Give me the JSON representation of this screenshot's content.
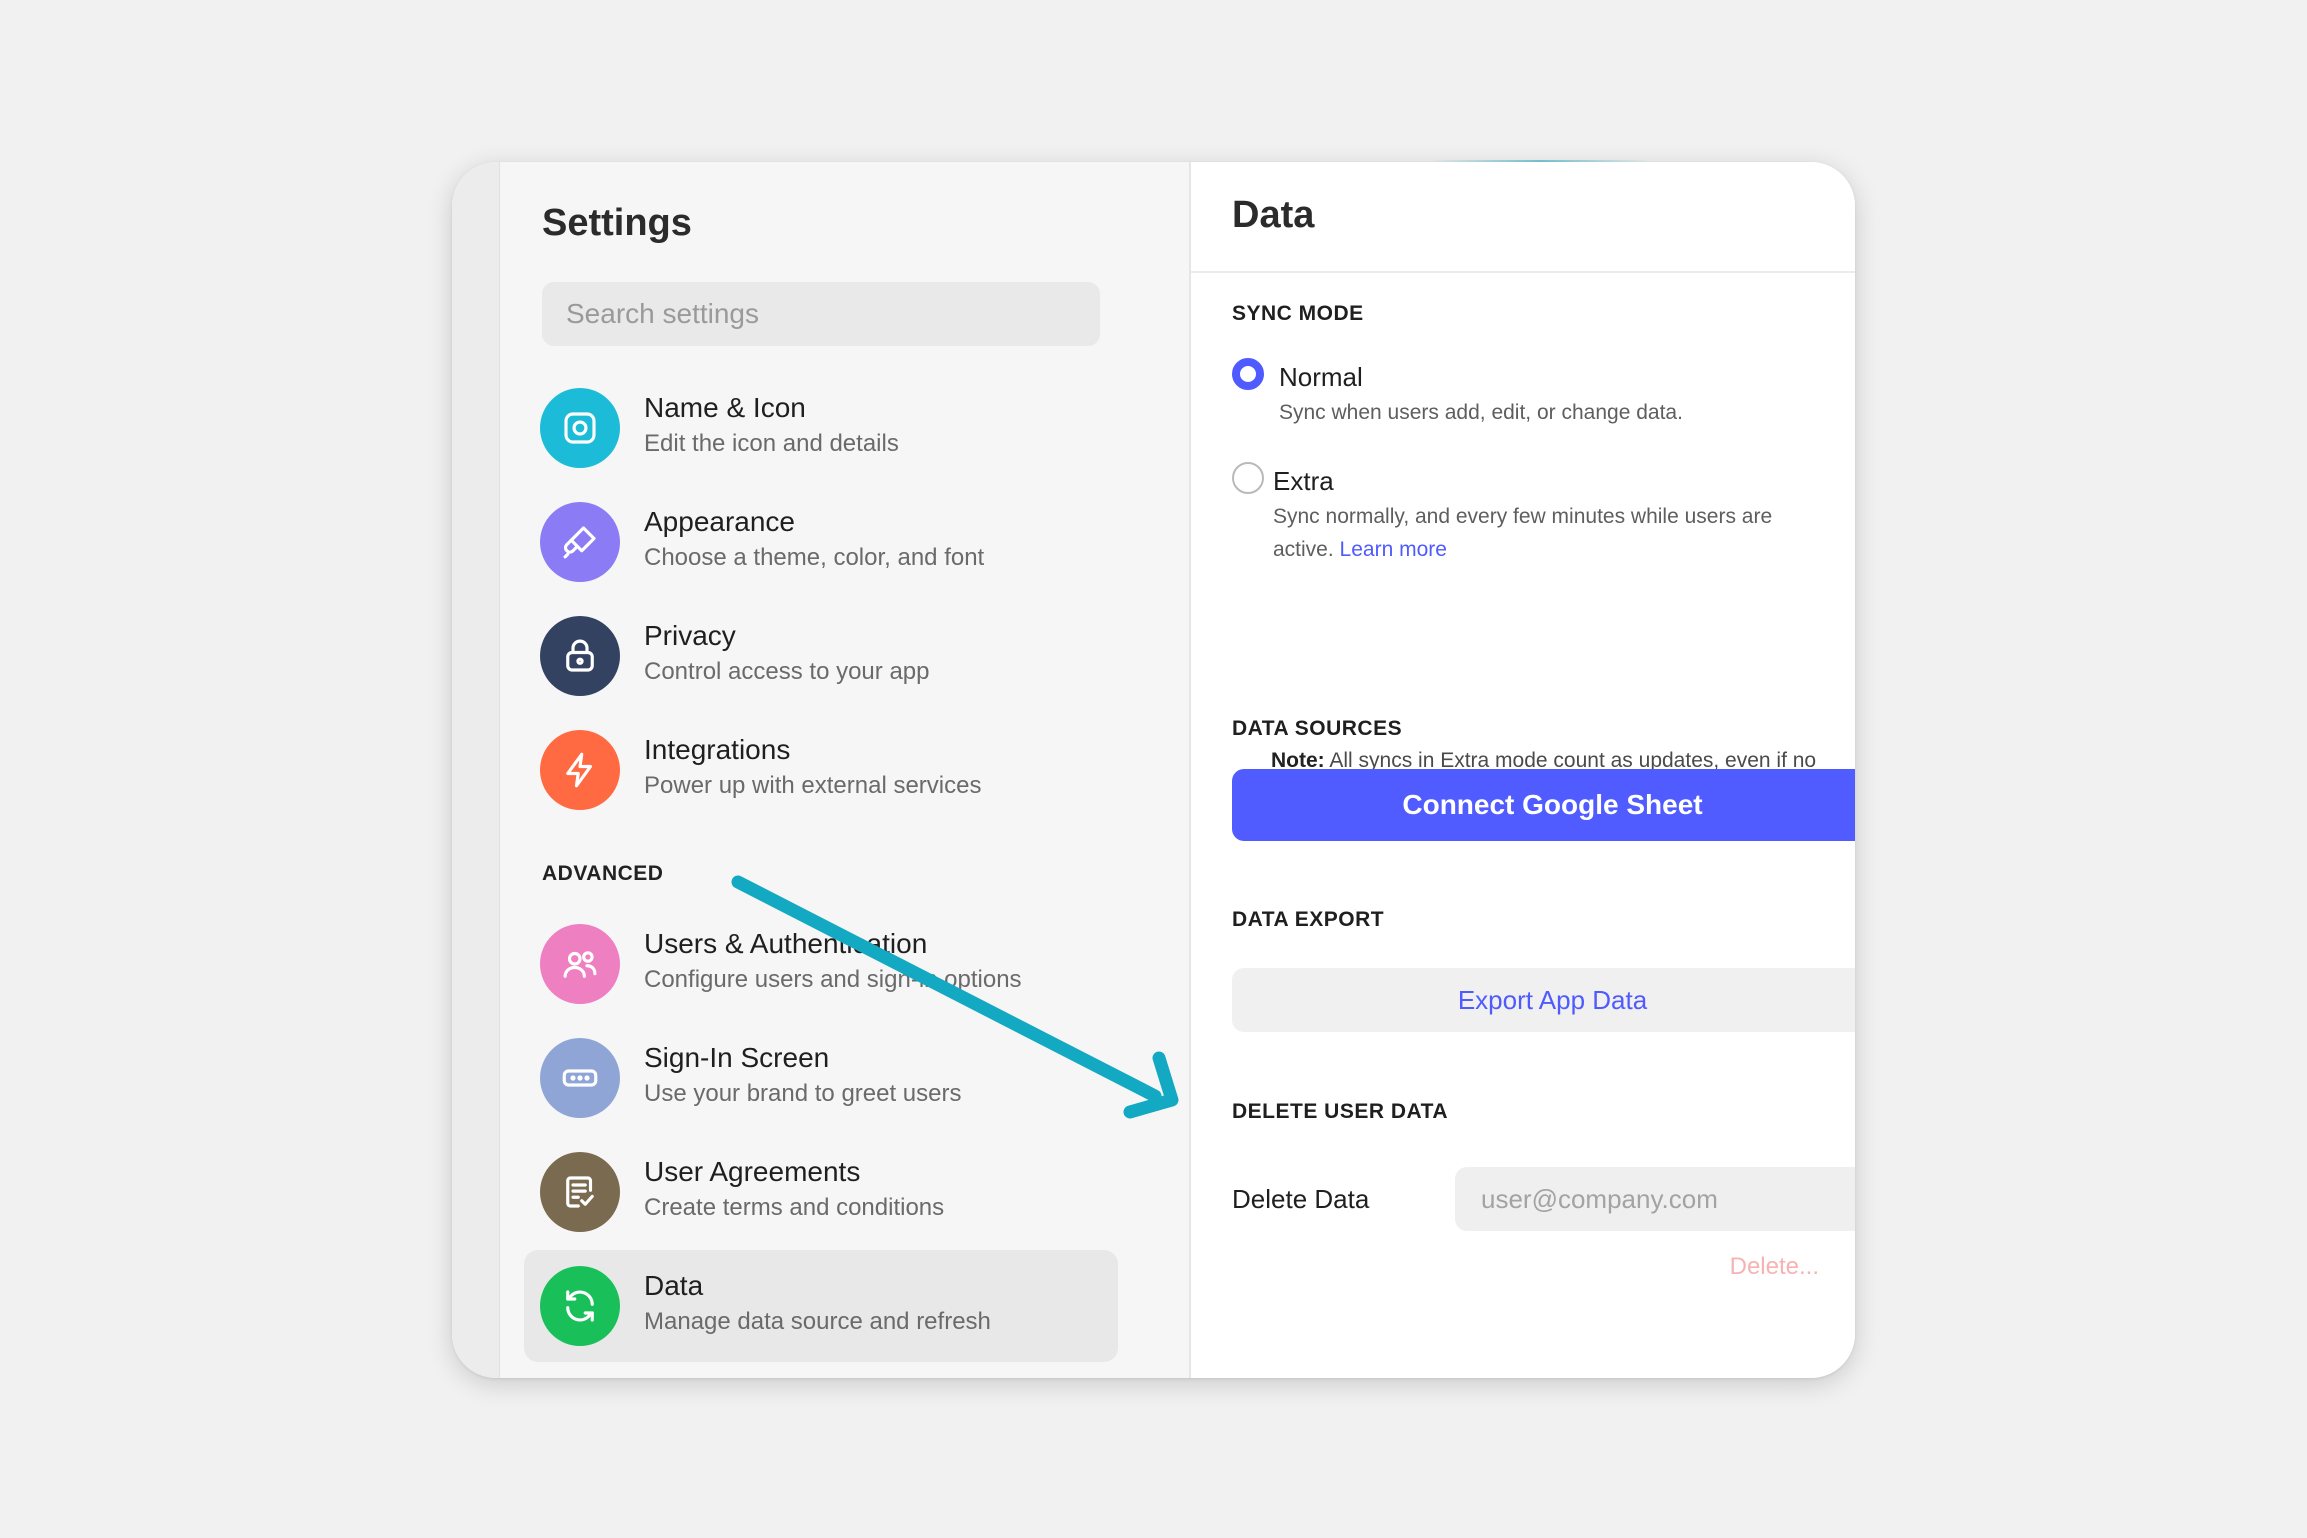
{
  "sidebar": {
    "title": "Settings",
    "search_placeholder": "Search settings",
    "items": [
      {
        "label": "Name & Icon",
        "desc": "Edit the icon and details",
        "icon": "app-icon",
        "color": "#1cbcd8"
      },
      {
        "label": "Appearance",
        "desc": "Choose a theme, color, and font",
        "icon": "brush-icon",
        "color": "#8b7cf6"
      },
      {
        "label": "Privacy",
        "desc": "Control access to your app",
        "icon": "lock-icon",
        "color": "#344262"
      },
      {
        "label": "Integrations",
        "desc": "Power up with external services",
        "icon": "lightning-icon",
        "color": "#ff6a42"
      }
    ],
    "advanced_label": "ADVANCED",
    "advanced_items": [
      {
        "label": "Users & Authentication",
        "desc": "Configure users and sign-in options",
        "icon": "users-icon",
        "color": "#ee7fc0"
      },
      {
        "label": "Sign-In Screen",
        "desc": "Use your brand to greet users",
        "icon": "password-field-icon",
        "color": "#8fa5d6"
      },
      {
        "label": "User Agreements",
        "desc": "Create terms and conditions",
        "icon": "document-check-icon",
        "color": "#7a6a4f"
      },
      {
        "label": "Data",
        "desc": "Manage data source and refresh",
        "icon": "refresh-icon",
        "color": "#19c05a",
        "active": true
      }
    ]
  },
  "main": {
    "title": "Data",
    "sync_mode": {
      "heading": "SYNC MODE",
      "options": [
        {
          "label": "Normal",
          "desc": "Sync when users add, edit, or change data.",
          "checked": true
        },
        {
          "label": "Extra",
          "desc_line1": "Sync normally, and every few minutes while users are",
          "desc_line2": "active.",
          "link": "Learn more",
          "checked": false
        }
      ],
      "note_bold": "Note:",
      "note_text": " All syncs in Extra mode count as updates, even if no data has changed."
    },
    "data_sources": {
      "heading": "DATA SOURCES",
      "button": "Connect Google Sheet"
    },
    "data_export": {
      "heading": "DATA EXPORT",
      "button": "Export App Data"
    },
    "delete_user_data": {
      "heading": "DELETE USER DATA",
      "field_label": "Delete Data",
      "placeholder": "user@company.com",
      "action": "Delete..."
    }
  },
  "colors": {
    "accent": "#4f5bff",
    "annotation_arrow": "#14a9c2",
    "danger_muted": "#f7b3b3"
  }
}
